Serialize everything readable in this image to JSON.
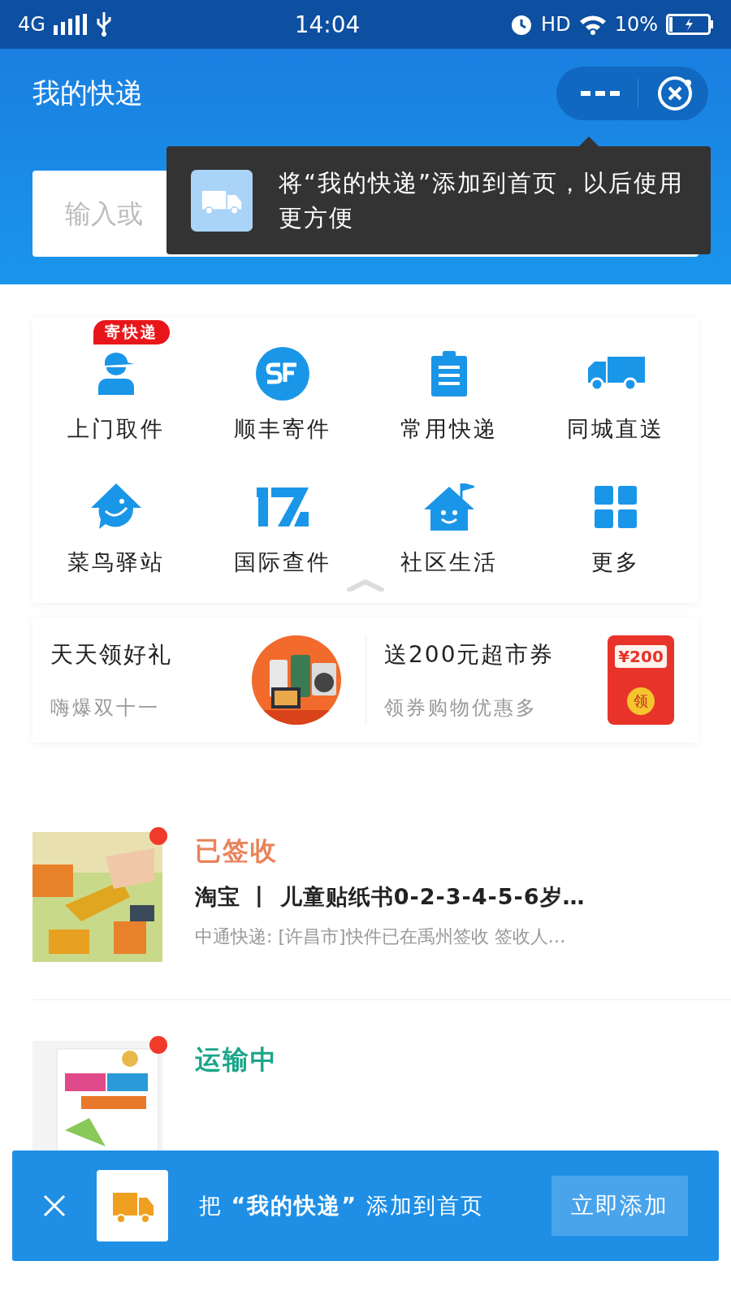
{
  "status_bar": {
    "network": "4G",
    "time": "14:04",
    "hd": "HD",
    "battery": "10%"
  },
  "header": {
    "title": "我的快递"
  },
  "search": {
    "placeholder": "输入或"
  },
  "tooltip": {
    "text": "将“我的快递”添加到首页，以后使用更方便"
  },
  "services": [
    {
      "label": "上门取件",
      "kind": "courier",
      "badge": "寄快递"
    },
    {
      "label": "顺丰寄件",
      "kind": "sf"
    },
    {
      "label": "常用快递",
      "kind": "clipboard"
    },
    {
      "label": "同城直送",
      "kind": "truck"
    },
    {
      "label": "菜鸟驿站",
      "kind": "bird"
    },
    {
      "label": "国际查件",
      "kind": "seventeen"
    },
    {
      "label": "社区生活",
      "kind": "house"
    },
    {
      "label": "更多",
      "kind": "grid"
    }
  ],
  "promos": [
    {
      "title": "天天领好礼",
      "subtitle": "嗨爆双十一",
      "kind": "picture"
    },
    {
      "title": "送200元超市券",
      "subtitle": "领券购物优惠多",
      "kind": "coupon",
      "coupon_amount": "¥200",
      "coupon_label": "领"
    }
  ],
  "packages": [
    {
      "status": "已签收",
      "color": "#e8835a",
      "unread": true,
      "title": "淘宝 丨 儿童贴纸书0-2-3-4-5-6岁…",
      "detail": "中通快递: [许昌市]快件已在禹州签收 签收人…"
    },
    {
      "status": "运输中",
      "color": "#1aa58a",
      "unread": true
    }
  ],
  "banner": {
    "text": "把 **“我的快递”** 添加到首页",
    "button": "立即添加"
  }
}
